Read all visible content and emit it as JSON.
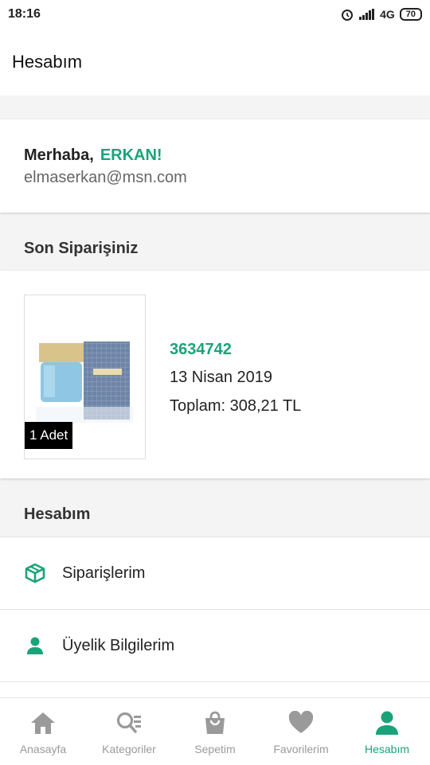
{
  "status_bar": {
    "time": "18:16",
    "network": "4G",
    "battery": "70"
  },
  "header": {
    "title": "Hesabım"
  },
  "greeting": {
    "hello": "Merhaba,",
    "name": "ERKAN!",
    "email": "elmaserkan@msn.com"
  },
  "last_order": {
    "section_title": "Son Siparişiniz",
    "quantity": "1 Adet",
    "order_number": "3634742",
    "date": "13 Nisan 2019",
    "total": "Toplam: 308,21 TL"
  },
  "account": {
    "section_title": "Hesabım",
    "items": [
      {
        "label": "Siparişlerim",
        "icon": "box-icon"
      },
      {
        "label": "Üyelik Bilgilerim",
        "icon": "user-icon"
      }
    ]
  },
  "bottom_nav": {
    "items": [
      {
        "label": "Anasayfa",
        "icon": "home-icon"
      },
      {
        "label": "Kategoriler",
        "icon": "category-search-icon"
      },
      {
        "label": "Sepetim",
        "icon": "bag-icon"
      },
      {
        "label": "Favorilerim",
        "icon": "heart-icon"
      },
      {
        "label": "Hesabım",
        "icon": "user-icon"
      }
    ],
    "active_index": 4
  },
  "colors": {
    "accent": "#1aa37a",
    "inactive": "#9a9a9a"
  }
}
